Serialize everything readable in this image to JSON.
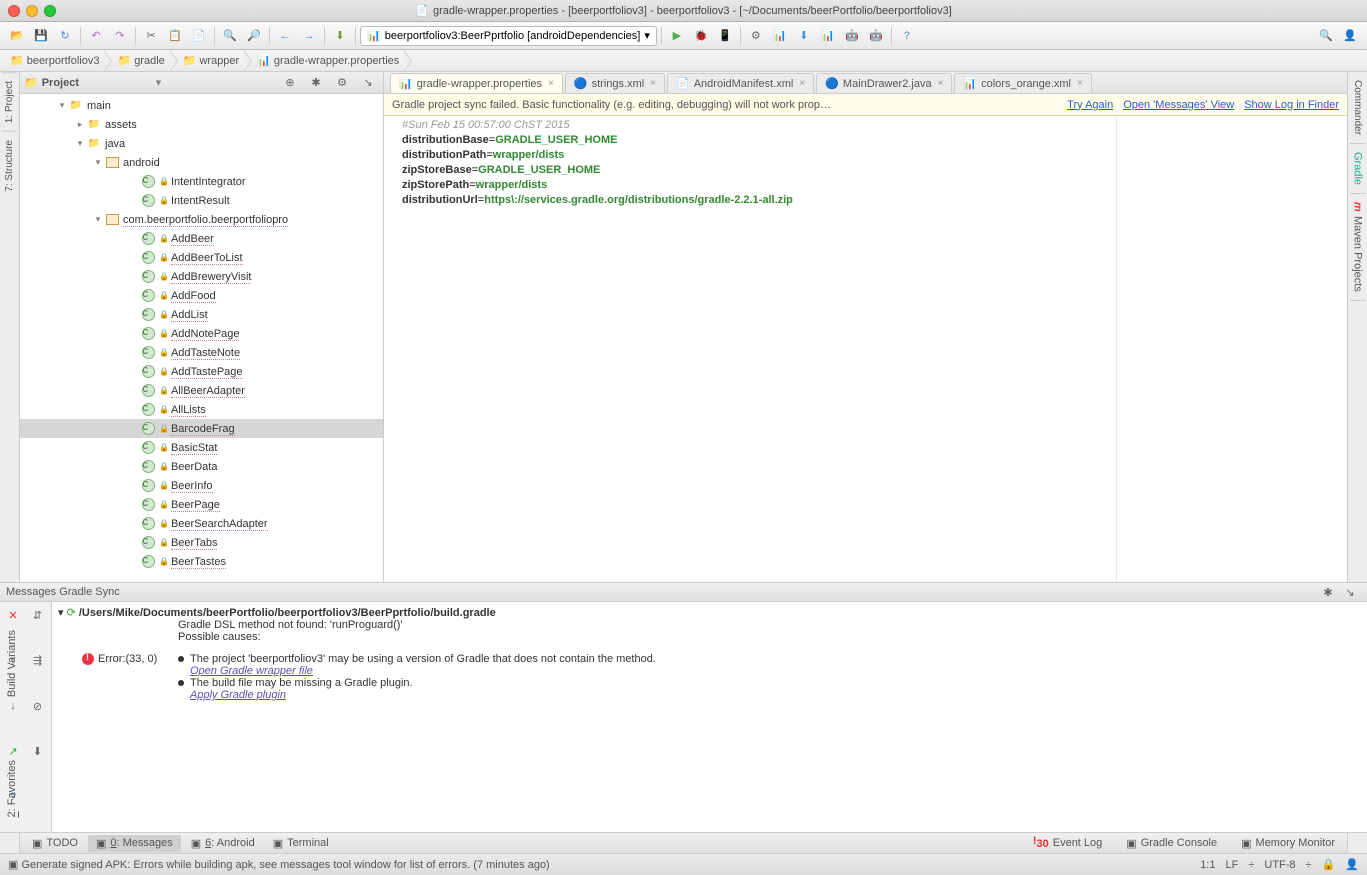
{
  "window": {
    "title": "gradle-wrapper.properties - [beerportfoliov3] - beerportfoliov3 - [~/Documents/beerPortfolio/beerportfoliov3]"
  },
  "runConfig": "beerportfoliov3:BeerPprtfolio [androidDependencies]",
  "breadcrumbs": [
    "beerportfoliov3",
    "gradle",
    "wrapper",
    "gradle-wrapper.properties"
  ],
  "leftRail": [
    "1: Project",
    "7: Structure"
  ],
  "rightRail": [
    "Commander",
    "Gradle",
    "Maven Projects"
  ],
  "projectPanel": {
    "title": "Project"
  },
  "tree": [
    {
      "d": 2,
      "exp": "▾",
      "ico": "fldr",
      "label": "main"
    },
    {
      "d": 3,
      "exp": "▸",
      "ico": "fldr",
      "label": "assets"
    },
    {
      "d": 3,
      "exp": "▾",
      "ico": "fldr",
      "label": "java"
    },
    {
      "d": 4,
      "exp": "▾",
      "ico": "pkg",
      "label": "android"
    },
    {
      "d": 6,
      "ico": "cls",
      "label": "IntentIntegrator"
    },
    {
      "d": 6,
      "ico": "cls",
      "label": "IntentResult"
    },
    {
      "d": 4,
      "exp": "▾",
      "ico": "pkg",
      "label": "com.beerportfolio.beerportfoliopro",
      "u": 1
    },
    {
      "d": 6,
      "ico": "cls",
      "label": "AddBeer",
      "u": 1
    },
    {
      "d": 6,
      "ico": "cls",
      "label": "AddBeerToList",
      "u": 1
    },
    {
      "d": 6,
      "ico": "cls",
      "label": "AddBreweryVisit",
      "u": 1
    },
    {
      "d": 6,
      "ico": "cls",
      "label": "AddFood",
      "u": 1
    },
    {
      "d": 6,
      "ico": "cls",
      "label": "AddList",
      "u": 1
    },
    {
      "d": 6,
      "ico": "cls",
      "label": "AddNotePage",
      "u": 1
    },
    {
      "d": 6,
      "ico": "cls",
      "label": "AddTasteNote",
      "u": 1
    },
    {
      "d": 6,
      "ico": "cls",
      "label": "AddTastePage",
      "u": 1
    },
    {
      "d": 6,
      "ico": "cls",
      "label": "AllBeerAdapter",
      "u": 1
    },
    {
      "d": 6,
      "ico": "cls",
      "label": "AllLists",
      "u": 1
    },
    {
      "d": 6,
      "ico": "cls",
      "label": "BarcodeFrag",
      "sel": 1,
      "u": 1
    },
    {
      "d": 6,
      "ico": "cls",
      "label": "BasicStat",
      "u": 1
    },
    {
      "d": 6,
      "ico": "cls",
      "label": "BeerData"
    },
    {
      "d": 6,
      "ico": "cls",
      "label": "BeerInfo",
      "u": 1
    },
    {
      "d": 6,
      "ico": "cls",
      "label": "BeerPage",
      "u": 1
    },
    {
      "d": 6,
      "ico": "cls",
      "label": "BeerSearchAdapter",
      "u": 1
    },
    {
      "d": 6,
      "ico": "cls",
      "label": "BeerTabs",
      "u": 1
    },
    {
      "d": 6,
      "ico": "cls",
      "label": "BeerTastes",
      "u": 1
    }
  ],
  "tabs": [
    {
      "label": "gradle-wrapper.properties",
      "active": true,
      "ico": "📊"
    },
    {
      "label": "strings.xml",
      "ico": "🔵"
    },
    {
      "label": "AndroidManifest.xml",
      "ico": "📄"
    },
    {
      "label": "MainDrawer2.java",
      "ico": "🔵"
    },
    {
      "label": "colors_orange.xml",
      "ico": "📊"
    }
  ],
  "banner": {
    "msg": "Gradle project sync failed. Basic functionality (e.g. editing, debugging) will not work prop…",
    "links": [
      "Try Again",
      "Open 'Messages' View",
      "Show Log in Finder"
    ]
  },
  "code": {
    "comment": "#Sun Feb 15 00:57:00 ChST 2015",
    "lines": [
      {
        "k": "distributionBase",
        "v": "GRADLE_USER_HOME"
      },
      {
        "k": "distributionPath",
        "v": "wrapper/dists"
      },
      {
        "k": "zipStoreBase",
        "v": "GRADLE_USER_HOME"
      },
      {
        "k": "zipStorePath",
        "v": "wrapper/dists"
      },
      {
        "k": "distributionUrl",
        "v": "https\\://services.gradle.org/distributions/gradle-2.2.1-all.zip"
      }
    ]
  },
  "messages": {
    "title": "Messages Gradle Sync",
    "path": "/Users/Mike/Documents/beerPortfolio/beerportfoliov3/BeerPprtfolio/build.gradle",
    "err0": "Gradle DSL method not found: 'runProguard()'",
    "err1": "Possible causes:",
    "errLoc": "Error:(33, 0)",
    "b1": "The project 'beerportfoliov3' may be using a version of Gradle that does not contain the method.",
    "l1": "Open Gradle wrapper file",
    "b2": "The build file may be missing a Gradle plugin.",
    "l2": "Apply Gradle plugin"
  },
  "bottomTabs": [
    {
      "label": "TODO"
    },
    {
      "label": "0: Messages",
      "u": 1,
      "active": true
    },
    {
      "label": "6: Android",
      "u": 1
    },
    {
      "label": "Terminal"
    }
  ],
  "bottomRight": [
    {
      "label": "Event Log",
      "badge": "30"
    },
    {
      "label": "Gradle Console"
    },
    {
      "label": "Memory Monitor"
    }
  ],
  "status": {
    "msg": "Generate signed APK: Errors while building apk, see messages tool window for list of errors. (7 minutes ago)",
    "pos": "1:1",
    "le": "LF",
    "enc": "UTF-8"
  }
}
